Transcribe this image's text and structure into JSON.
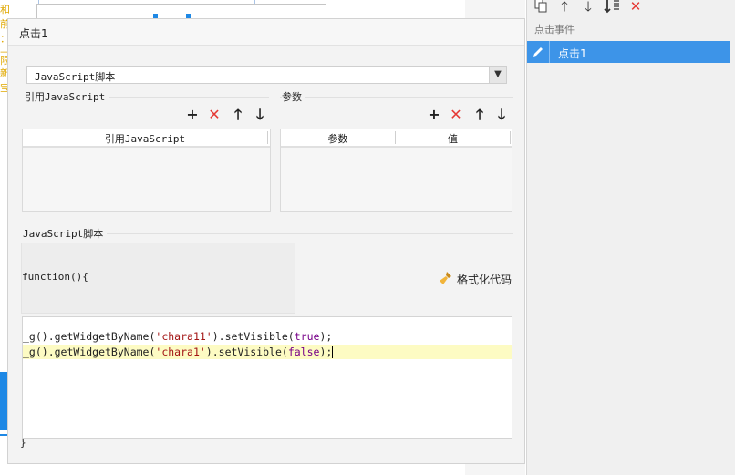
{
  "background": {
    "yellow_chars": [
      "和",
      "前",
      "：",
      "—",
      "限",
      "新",
      "宝"
    ]
  },
  "right_panel": {
    "toolbar": {
      "copy_icon": "copy-icon",
      "up_icon": "arrow-up-icon",
      "down_icon": "arrow-down-icon",
      "move_bottom_icon": "move-to-bottom-icon",
      "delete_icon": "delete-icon",
      "up_glyph": "🡑",
      "down_glyph": "🡓",
      "delete_glyph": "✕"
    },
    "header": "点击事件",
    "items": [
      {
        "label": "点击1",
        "icon": "edit-icon",
        "selected": true
      }
    ]
  },
  "dialog": {
    "title": "点击1",
    "script_type": "JavaScript脚本",
    "ref_section_label": "引用JavaScript",
    "params_section_label": "参数",
    "toolbar": {
      "add": "+",
      "delete": "✕",
      "up": "🡑",
      "down": "🡓"
    },
    "ref_table": {
      "columns": [
        "引用JavaScript"
      ]
    },
    "params_table": {
      "columns": [
        "参数",
        "值"
      ]
    },
    "script_section_label": "JavaScript脚本",
    "function_header": "function(){",
    "format_button": "格式化代码",
    "closing_brace": "}",
    "code": {
      "line1": {
        "prefix": "_g().getWidgetByName(",
        "arg": "'chara11'",
        "middle": ").setVisible(",
        "value": "true",
        "suffix": ");"
      },
      "line2": {
        "prefix": "_g().getWidgetByName(",
        "arg": "'chara1'",
        "middle": ").setVisible(",
        "value": "false",
        "suffix": ");"
      }
    }
  },
  "colors": {
    "accent": "#3d94e8",
    "delete": "#e53935",
    "active_line": "#fdfbc3"
  }
}
